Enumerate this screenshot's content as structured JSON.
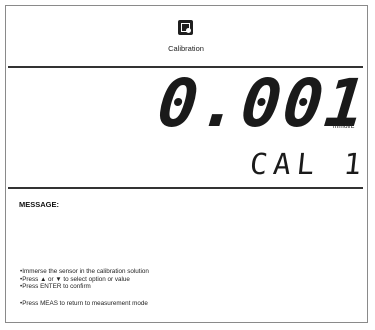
{
  "header": {
    "mode_label": "Calibration",
    "mode_icon": "calibration-icon"
  },
  "display": {
    "reading": "0.001",
    "unit": "mmol/L",
    "status": "CAL 1"
  },
  "message": {
    "title": "MESSAGE:",
    "instructions": [
      "Immerse the sensor in the calibration solution",
      "Press ▲ or ▼ to select option or value",
      "Press ENTER to confirm",
      "Press MEAS to return to measurement mode"
    ]
  }
}
